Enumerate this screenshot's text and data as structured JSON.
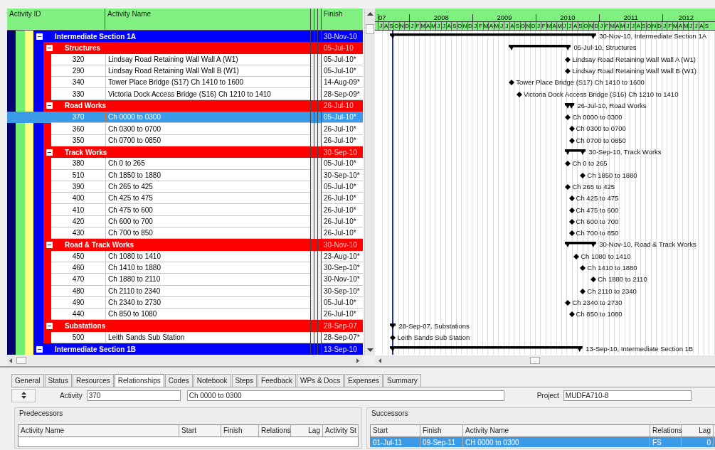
{
  "table": {
    "columns": [
      "Activity ID",
      "Activity Name",
      "Finish"
    ],
    "rows": [
      {
        "kind": "wbs",
        "name": "Intermediate Section 1A",
        "finish": "30-Nov-10",
        "expanded": true,
        "bar_label": "30-Nov-10, Intermediate Section 1A",
        "children": [
          {
            "kind": "wbs",
            "name": "Structures",
            "finish": "05-Jul-10",
            "expanded": true,
            "bar_label": "05-Jul-10, Structures",
            "children": [
              {
                "kind": "activity",
                "id": "320",
                "name": "Lindsay Road Retaining Wall Wall A (W1)",
                "finish": "05-Jul-10*",
                "selected": false,
                "bar_label": "Lindsay Road Retaining Wall Wall A (W1)"
              },
              {
                "kind": "activity",
                "id": "290",
                "name": "Lindsay Road Retaining Wall Wall B (W1)",
                "finish": "05-Jul-10*",
                "selected": false,
                "bar_label": "Lindsay Road Retaining Wall Wall B (W1)"
              },
              {
                "kind": "activity",
                "id": "340",
                "name": "Tower Place Bridge (S17) Ch 1410 to 1600",
                "finish": "14-Aug-09*",
                "selected": false,
                "bar_label": "Tower Place Bridge (S17) Ch 1410 to 1600"
              },
              {
                "kind": "activity",
                "id": "330",
                "name": "Victoria Dock Access Bridge (S16) Ch 1210 to 1410",
                "finish": "28-Sep-09*",
                "selected": false,
                "bar_label": "Victoria Dock Access Bridge (S16) Ch 1210 to 1410"
              }
            ]
          },
          {
            "kind": "wbs",
            "name": "Road Works",
            "finish": "26-Jul-10",
            "expanded": true,
            "bar_label": "26-Jul-10, Road Works",
            "children": [
              {
                "kind": "activity",
                "id": "370",
                "name": "Ch 0000 to 0300",
                "finish": "05-Jul-10*",
                "selected": true,
                "bar_label": "Ch 0000 to 0300"
              },
              {
                "kind": "activity",
                "id": "360",
                "name": "Ch 0300 to 0700",
                "finish": "26-Jul-10*",
                "selected": false,
                "bar_label": "Ch 0300 to 0700"
              },
              {
                "kind": "activity",
                "id": "350",
                "name": "Ch 0700 to 0850",
                "finish": "26-Jul-10*",
                "selected": false,
                "bar_label": "Ch 0700 to 0850"
              }
            ]
          },
          {
            "kind": "wbs",
            "name": "Track Works",
            "finish": "30-Sep-10",
            "expanded": true,
            "bar_label": "30-Sep-10, Track Works",
            "children": [
              {
                "kind": "activity",
                "id": "380",
                "name": "Ch 0 to 265",
                "finish": "05-Jul-10*",
                "selected": false,
                "bar_label": "Ch 0 to 265"
              },
              {
                "kind": "activity",
                "id": "510",
                "name": "Ch 1850 to 1880",
                "finish": "30-Sep-10*",
                "selected": false,
                "bar_label": "Ch 1850 to 1880"
              },
              {
                "kind": "activity",
                "id": "390",
                "name": "Ch 265 to 425",
                "finish": "05-Jul-10*",
                "selected": false,
                "bar_label": "Ch 265 to 425"
              },
              {
                "kind": "activity",
                "id": "400",
                "name": "Ch 425 to 475",
                "finish": "26-Jul-10*",
                "selected": false,
                "bar_label": "Ch 425 to 475"
              },
              {
                "kind": "activity",
                "id": "410",
                "name": "Ch 475 to 600",
                "finish": "26-Jul-10*",
                "selected": false,
                "bar_label": "Ch 475 to 600"
              },
              {
                "kind": "activity",
                "id": "420",
                "name": "Ch 600 to 700",
                "finish": "26-Jul-10*",
                "selected": false,
                "bar_label": "Ch 600 to 700"
              },
              {
                "kind": "activity",
                "id": "430",
                "name": "Ch 700 to 850",
                "finish": "26-Jul-10*",
                "selected": false,
                "bar_label": "Ch 700 to 850"
              }
            ]
          },
          {
            "kind": "wbs",
            "name": "Road & Track Works",
            "finish": "30-Nov-10",
            "expanded": true,
            "bar_label": "30-Nov-10, Road & Track Works",
            "children": [
              {
                "kind": "activity",
                "id": "450",
                "name": "Ch 1080 to 1410",
                "finish": "23-Aug-10*",
                "selected": false,
                "bar_label": "Ch 1080 to 1410"
              },
              {
                "kind": "activity",
                "id": "460",
                "name": "Ch 1410 to 1880",
                "finish": "30-Sep-10*",
                "selected": false,
                "bar_label": "Ch 1410 to 1880"
              },
              {
                "kind": "activity",
                "id": "470",
                "name": "Ch 1880 to 2110",
                "finish": "30-Nov-10*",
                "selected": false,
                "bar_label": "Ch 1880 to 2110"
              },
              {
                "kind": "activity",
                "id": "480",
                "name": "Ch 2110 to 2340",
                "finish": "30-Sep-10*",
                "selected": false,
                "bar_label": "Ch 2110 to 2340"
              },
              {
                "kind": "activity",
                "id": "490",
                "name": "Ch 2340 to 2730",
                "finish": "05-Jul-10*",
                "selected": false,
                "bar_label": "Ch 2340 to 2730"
              },
              {
                "kind": "activity",
                "id": "440",
                "name": "Ch 850 to 1080",
                "finish": "26-Jul-10*",
                "selected": false,
                "bar_label": "Ch 850 to 1080"
              }
            ]
          },
          {
            "kind": "wbs",
            "name": "Substations",
            "finish": "28-Sep-07",
            "expanded": true,
            "bar_label": "28-Sep-07, Substations",
            "children": [
              {
                "kind": "activity",
                "id": "500",
                "name": "Leith Sands Sub Station",
                "finish": "28-Sep-07*",
                "selected": false,
                "bar_label": "Leith Sands Sub Station"
              }
            ]
          }
        ]
      },
      {
        "kind": "wbs",
        "name": "Intermediate Section 1B",
        "finish": "13-Sep-10",
        "expanded": true,
        "bar_label": "13-Sep-10, Intermediate Section 1B"
      }
    ]
  },
  "timescale": {
    "years": [
      {
        "label": "07",
        "months": [
          "J",
          "A",
          "S",
          "O",
          "N",
          "D"
        ]
      },
      {
        "label": "2008",
        "months": [
          "J",
          "F",
          "M",
          "A",
          "M",
          "J",
          "J",
          "A",
          "S",
          "O",
          "N",
          "D"
        ]
      },
      {
        "label": "2009",
        "months": [
          "J",
          "F",
          "M",
          "A",
          "M",
          "J",
          "J",
          "A",
          "S",
          "O",
          "N",
          "D"
        ]
      },
      {
        "label": "2010",
        "months": [
          "J",
          "F",
          "M",
          "A",
          "M",
          "J",
          "J",
          "A",
          "S",
          "O",
          "N",
          "D"
        ]
      },
      {
        "label": "2011",
        "months": [
          "J",
          "F",
          "M",
          "A",
          "M",
          "J",
          "J",
          "A",
          "S",
          "O",
          "N",
          "D"
        ]
      },
      {
        "label": "2012",
        "months": [
          "J",
          "F",
          "M",
          "A",
          "M",
          "J",
          "J",
          "A",
          "S"
        ]
      }
    ]
  },
  "details": {
    "tabs": [
      {
        "label": "General",
        "selected": false
      },
      {
        "label": "Status",
        "selected": false
      },
      {
        "label": "Resources",
        "selected": false
      },
      {
        "label": "Relationships",
        "selected": true
      },
      {
        "label": "Codes",
        "selected": false
      },
      {
        "label": "Notebook",
        "selected": false
      },
      {
        "label": "Steps",
        "selected": false
      },
      {
        "label": "Feedback",
        "selected": false
      },
      {
        "label": "WPs & Docs",
        "selected": false
      },
      {
        "label": "Expenses",
        "selected": false
      },
      {
        "label": "Summary",
        "selected": false
      }
    ],
    "activity_label": "Activity",
    "activity_id": "370",
    "activity_name": "Ch 0000 to 0300",
    "project_label": "Project",
    "project": "MUDFA710-8",
    "predecessors": {
      "title": "Predecessors",
      "columns": [
        "Activity Name",
        "Start",
        "Finish",
        "Relations",
        "Lag",
        "Activity St"
      ]
    },
    "successors": {
      "title": "Successors",
      "columns": [
        "Start",
        "Finish",
        "Activity Name",
        "Relations",
        "Lag"
      ],
      "rows": [
        {
          "start": "01-Jul-11",
          "finish": "09-Sep-11",
          "name": "CH 0000 to 0300",
          "relation": "FS",
          "lag": "0",
          "selected": true
        }
      ]
    }
  }
}
